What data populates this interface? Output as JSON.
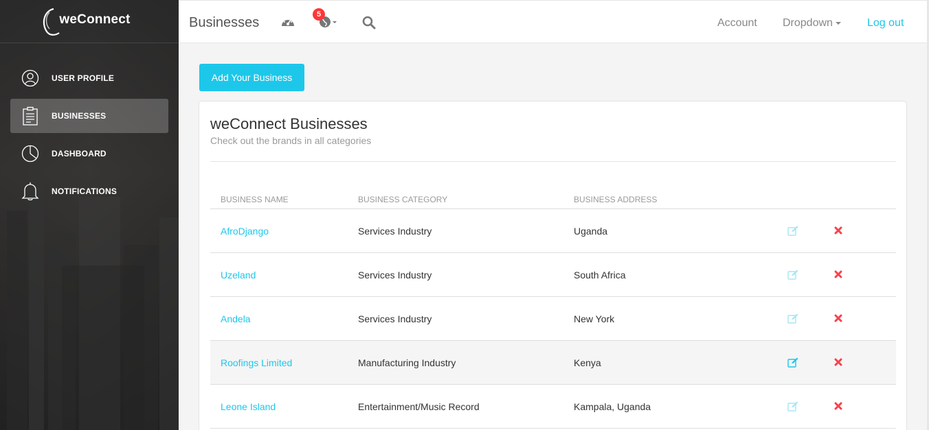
{
  "app": {
    "logo": "weConnect"
  },
  "sidebar": {
    "items": [
      {
        "label": "USER PROFILE",
        "icon": "user-circle-icon",
        "active": false
      },
      {
        "label": "BUSINESSES",
        "icon": "clipboard-icon",
        "active": true
      },
      {
        "label": "DASHBOARD",
        "icon": "pie-chart-icon",
        "active": false
      },
      {
        "label": "NOTIFICATIONS",
        "icon": "bell-icon",
        "active": false
      }
    ]
  },
  "topbar": {
    "title": "Businesses",
    "notification_count": "5",
    "links": {
      "account": "Account",
      "dropdown": "Dropdown",
      "logout": "Log out"
    }
  },
  "main": {
    "add_button": "Add Your Business",
    "card": {
      "title": "weConnect Businesses",
      "subtitle": "Check out the brands in all categories"
    },
    "table": {
      "headers": {
        "name": "BUSINESS NAME",
        "category": "BUSINESS CATEGORY",
        "address": "BUSINESS ADDRESS"
      },
      "rows": [
        {
          "name": "AfroDjango",
          "category": "Services Industry",
          "address": "Uganda"
        },
        {
          "name": "Uzeland",
          "category": "Services Industry",
          "address": "South Africa"
        },
        {
          "name": "Andela",
          "category": "Services Industry",
          "address": "New York"
        },
        {
          "name": "Roofings Limited",
          "category": "Manufacturing Industry",
          "address": "Kenya"
        },
        {
          "name": "Leone Island",
          "category": "Entertainment/Music Record",
          "address": "Kampala, Uganda"
        }
      ]
    }
  },
  "colors": {
    "accent": "#1dc7ea",
    "danger": "#fb404b",
    "badge": "#ff3636"
  }
}
